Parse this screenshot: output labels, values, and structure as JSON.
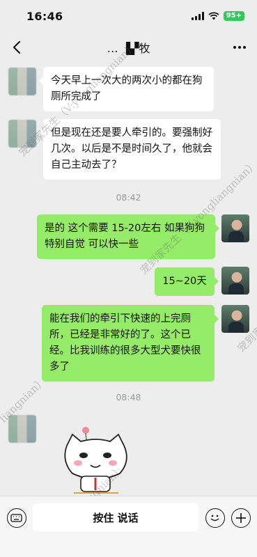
{
  "status_bar": {
    "time": "16:46",
    "battery": "95+",
    "icons": [
      "signal-icon",
      "wifi-icon",
      "battery-icon"
    ]
  },
  "nav": {
    "title": "… ▐▞牧",
    "back_icon": "chevron-left-icon",
    "more_icon": "more-dots-icon"
  },
  "messages": [
    {
      "side": "left",
      "text": "今天早上一次大的两次小的都在狗厕所完成了"
    },
    {
      "side": "left",
      "text": "但是现在还是要人牵引的。要强制好几次。以后是不是时间久了，他就会自己主动去了？"
    },
    {
      "side": "right",
      "text": "是的 这个需要 15-20左右 如果狗狗特别自觉 可以快一些"
    },
    {
      "side": "right",
      "text": "15~20天"
    },
    {
      "side": "left",
      "text": "能在我们的牵引下快速的上完厕所，已经是非常好的了。这个已经。比我训练的很多大型犬要快很多了"
    }
  ],
  "timestamps": [
    "08:42",
    "08:48"
  ],
  "watermark": {
    "text_a": "宠到家先生（V:yongliangnian）",
    "text_b": "宠到家先生（V:yongliangnian）",
    "text_c": "宠到家",
    "text_d": "liangnian）",
    "text_e": "家先生（V:yongliangnian）"
  },
  "input_bar": {
    "hold_to_talk": "按住 说话",
    "left_icon": "voice-keyboard-icon",
    "emoji_icon": "emoji-icon",
    "plus_icon": "plus-icon"
  },
  "colors": {
    "background": "#ededed",
    "bubble_left": "#ffffff",
    "bubble_right": "#95ec69",
    "battery": "#34c759"
  }
}
